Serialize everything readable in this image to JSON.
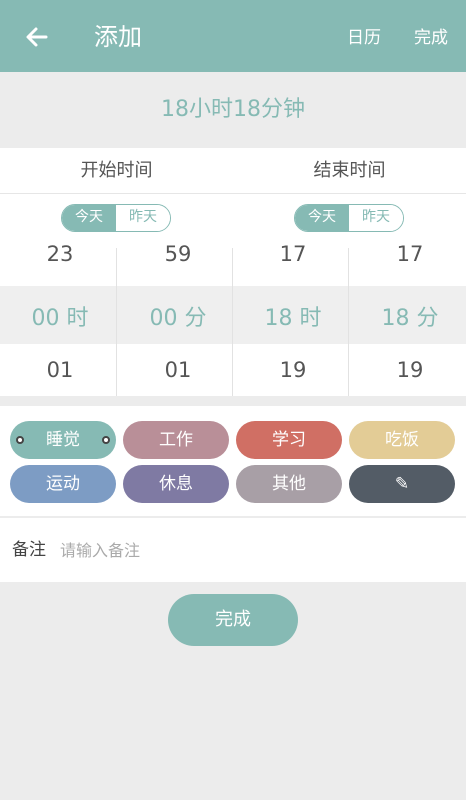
{
  "header": {
    "title": "添加",
    "calendar_label": "日历",
    "done_label": "完成"
  },
  "duration": "18小时18分钟",
  "start": {
    "label": "开始时间",
    "day_toggle": {
      "today": "今天",
      "yesterday": "昨天",
      "selected": "今天"
    },
    "hour": {
      "prev": "23",
      "selected": "00 时",
      "next": "01"
    },
    "minute": {
      "prev": "59",
      "selected": "00 分",
      "next": "01"
    }
  },
  "end": {
    "label": "结束时间",
    "day_toggle": {
      "today": "今天",
      "yesterday": "昨天",
      "selected": "今天"
    },
    "hour": {
      "prev": "17",
      "selected": "18 时",
      "next": "19"
    },
    "minute": {
      "prev": "17",
      "selected": "18 分",
      "next": "19"
    }
  },
  "categories": [
    {
      "label": "睡觉",
      "color": "#86bab4",
      "selected": true
    },
    {
      "label": "工作",
      "color": "#b98f98"
    },
    {
      "label": "学习",
      "color": "#d06f64"
    },
    {
      "label": "吃饭",
      "color": "#e3cc96"
    },
    {
      "label": "运动",
      "color": "#7d9cc4"
    },
    {
      "label": "休息",
      "color": "#7f7aa3"
    },
    {
      "label": "其他",
      "color": "#a89fa6"
    },
    {
      "label": "✎",
      "color": "#535c66",
      "icon": "pencil-icon"
    }
  ],
  "note": {
    "label": "备注",
    "placeholder": "请输入备注"
  },
  "submit_label": "完成"
}
